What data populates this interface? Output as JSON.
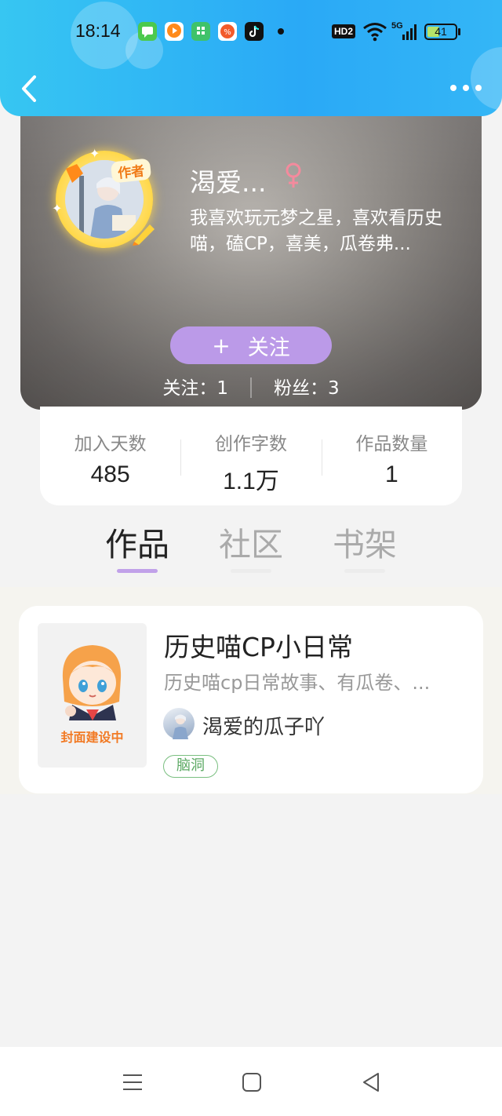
{
  "status_bar": {
    "time": "18:14",
    "hd_label": "HD2",
    "network_label": "5G",
    "battery_level": "41",
    "icons": [
      "messages-icon",
      "video-app-icon",
      "store-icon",
      "red-app-icon",
      "tiktok-icon",
      "notification-dot-icon",
      "wifi-icon",
      "signal-icon",
      "battery-icon"
    ],
    "battery_color": "#b6e36a"
  },
  "header": {
    "back_icon": "chevron-left-icon",
    "more_icon": "more-dots-icon",
    "bar_color": "#2aa9f6"
  },
  "profile": {
    "username": "渴爱...",
    "gender_icon": "female-icon",
    "author_badge": "作者",
    "bio": "我喜欢玩元梦之星，喜欢看历史喵，磕CP，喜美，瓜卷弗...",
    "follow_button": {
      "plus": "+",
      "label": "关注",
      "color": "#bb9ae8"
    },
    "following_label": "关注：1",
    "followers_label": "粉丝：3"
  },
  "stats": [
    {
      "label": "加入天数",
      "value": "485"
    },
    {
      "label": "创作字数",
      "value": "1.1万"
    },
    {
      "label": "作品数量",
      "value": "1"
    }
  ],
  "tabs": [
    {
      "label": "作品",
      "active": true
    },
    {
      "label": "社区",
      "active": false
    },
    {
      "label": "书架",
      "active": false
    }
  ],
  "works": [
    {
      "title": "历史喵CP小日常",
      "description": "历史喵cp日常故事、有瓜卷、...",
      "cover_text": "封面建设中",
      "author": "渴爱的瓜子吖",
      "tag": "脑洞",
      "tag_color": "#5aa862"
    }
  ],
  "nav_bar": {
    "icons": [
      "menu-icon",
      "home-square-icon",
      "back-triangle-icon"
    ]
  }
}
